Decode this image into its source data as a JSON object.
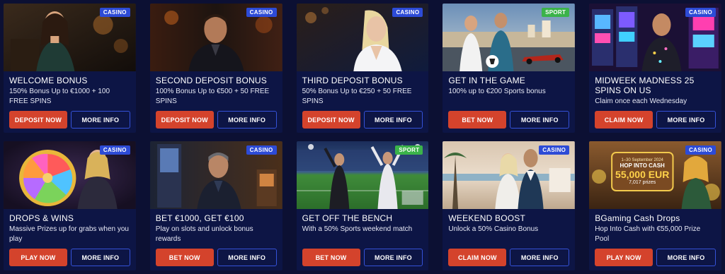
{
  "colors": {
    "page_bg": "#0c1033",
    "card_bg": "#0d1545",
    "primary_button": "#d4432c",
    "secondary_border": "#3552d8",
    "casino_badge": "#2d4bd6",
    "sport_badge": "#3bb34a"
  },
  "cards": [
    {
      "badge": "CASINO",
      "badge_type": "casino",
      "title": "WELCOME BONUS",
      "description": "150% Bonus Up to €1000 + 100 FREE SPINS",
      "primary_label": "DEPOSIT NOW",
      "secondary_label": "MORE INFO",
      "image_icon": "woman-portrait-image"
    },
    {
      "badge": "CASINO",
      "badge_type": "casino",
      "title": "SECOND DEPOSIT BONUS",
      "description": "100% Bonus Up to €500 + 50 FREE SPINS",
      "primary_label": "DEPOSIT NOW",
      "secondary_label": "MORE INFO",
      "image_icon": "man-portrait-image"
    },
    {
      "badge": "CASINO",
      "badge_type": "casino",
      "title": "THIRD DEPOSIT BONUS",
      "description": "50% Bonus Up to €250 + 50 FREE SPINS",
      "primary_label": "DEPOSIT NOW",
      "secondary_label": "MORE INFO",
      "image_icon": "blonde-woman-image"
    },
    {
      "badge": "SPORT",
      "badge_type": "sport",
      "title": "GET IN THE GAME",
      "description": "100% up to €200 Sports bonus",
      "primary_label": "BET NOW",
      "secondary_label": "MORE INFO",
      "image_icon": "sport-players-image"
    },
    {
      "badge": "CASINO",
      "badge_type": "casino",
      "title": "MIDWEEK MADNESS 25 SPINS ON US",
      "description": "Claim once each Wednesday",
      "primary_label": "CLAIM NOW",
      "secondary_label": "MORE INFO",
      "image_icon": "slot-machines-image"
    },
    {
      "badge": "CASINO",
      "badge_type": "casino",
      "title": "DROPS & WINS",
      "description": "Massive Prizes up for grabs when you play",
      "primary_label": "PLAY NOW",
      "secondary_label": "MORE INFO",
      "image_icon": "prize-wheel-image"
    },
    {
      "badge": "CASINO",
      "badge_type": "casino",
      "title": "BET €1000, GET €100",
      "description": "Play on slots and unlock bonus rewards",
      "primary_label": "BET NOW",
      "secondary_label": "MORE INFO",
      "image_icon": "casino-man-image"
    },
    {
      "badge": "SPORT",
      "badge_type": "sport",
      "title": "GET OFF THE BENCH",
      "description": "With a 50% Sports weekend match",
      "primary_label": "BET NOW",
      "secondary_label": "MORE INFO",
      "image_icon": "stadium-image"
    },
    {
      "badge": "CASINO",
      "badge_type": "casino",
      "title": "WEEKEND BOOST",
      "description": "Unlock a 50% Casino Bonus",
      "primary_label": "CLAIM NOW",
      "secondary_label": "MORE INFO",
      "image_icon": "couple-beach-image"
    },
    {
      "badge": "CASINO",
      "badge_type": "casino",
      "title": "BGaming Cash Drops",
      "description": "Hop Into Cash with €55,000 Prize Pool",
      "primary_label": "PLAY NOW",
      "secondary_label": "MORE INFO",
      "image_icon": "cash-drops-banner-image",
      "banner_date": "1–30 September 2024",
      "banner_title": "HOP INTO CASH",
      "banner_amount": "55,000 EUR",
      "banner_prizes": "7,017 prizes"
    }
  ]
}
